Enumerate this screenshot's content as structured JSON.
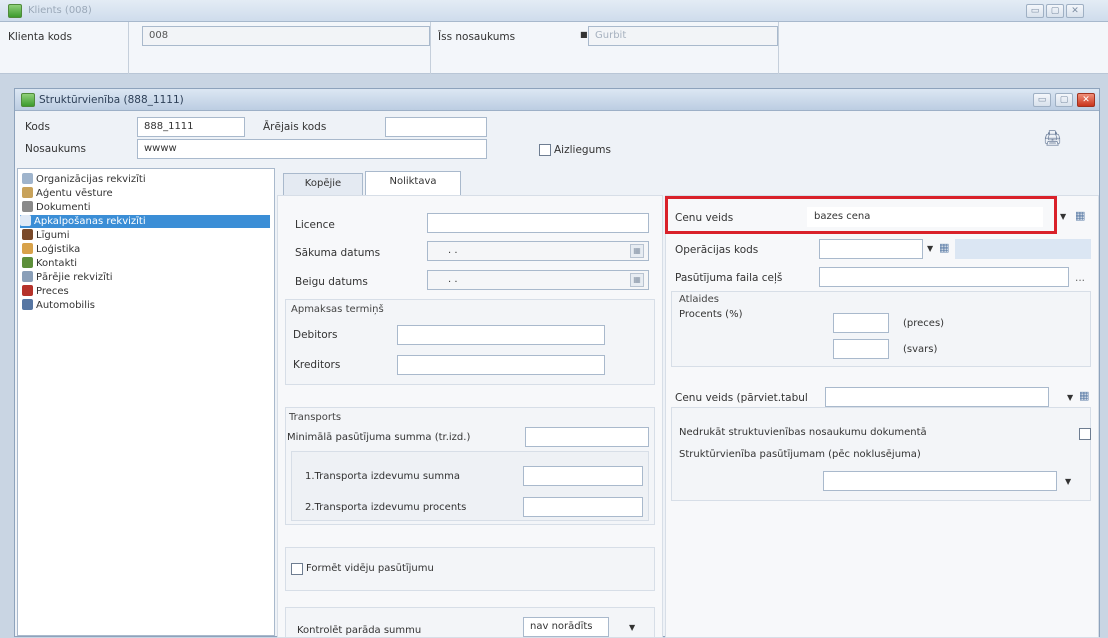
{
  "outer_window": {
    "title": "Klients (008)"
  },
  "client": {
    "code_label": "Klienta kods",
    "code_value": "008",
    "short_name_label": "Īss nosaukums",
    "short_name_value": "Gurbit"
  },
  "inner_window": {
    "title": "Struktūrvienība (888_1111)"
  },
  "form": {
    "code_label": "Kods",
    "code_value": "888_1111",
    "external_code_label": "Ārējais kods",
    "external_code_value": "",
    "name_label": "Nosaukums",
    "name_value": "wwww",
    "blocked_label": "Aizliegums"
  },
  "tree": {
    "items": [
      {
        "label": "Organizācijas rekvizīti",
        "color": "#9fb4cc"
      },
      {
        "label": "Aģentu vēsture",
        "color": "#c8a25a"
      },
      {
        "label": "Dokumenti",
        "color": "#8a8a8a"
      },
      {
        "label": "Apkalpošanas rekvizīti",
        "color": "#3b8ed6",
        "selected": true
      },
      {
        "label": "Līgumi",
        "color": "#7a4a2a"
      },
      {
        "label": "Loģistika",
        "color": "#d8a24a"
      },
      {
        "label": "Kontakti",
        "color": "#5d8f3a"
      },
      {
        "label": "Pārējie rekvizīti",
        "color": "#8a9fb8"
      },
      {
        "label": "Preces",
        "color": "#b5322a"
      },
      {
        "label": "Automobilis",
        "color": "#5676a3"
      }
    ]
  },
  "tabs": [
    {
      "label": "Kopējie",
      "active": false
    },
    {
      "label": "Noliktava",
      "active": true
    }
  ],
  "left": {
    "license_label": "Licence",
    "license_value": "",
    "start_date_label": "Sākuma datums",
    "start_date_value": ". .",
    "end_date_label": "Beigu datums",
    "end_date_value": ". .",
    "payment_term_label": "Apmaksas termiņš",
    "debtors_label": "Debitors",
    "debtors_value": "",
    "creditors_label": "Kreditors",
    "creditors_value": "",
    "transport_label": "Transports",
    "min_order_label": "Minimālā pasūtījuma summa (tr.izd.)",
    "min_order_value": "",
    "transport_cost_sum_label": "1.Transporta izdevumu summa",
    "transport_cost_sum_value": "",
    "transport_cost_pct_label": "2.Transporta izdevumu procents",
    "transport_cost_pct_value": "",
    "form_avg_order_label": "Formēt vidēju pasūtījumu",
    "check_debt_label": "Kontrolēt parāda summu",
    "check_debt_value": "nav norādīts"
  },
  "right": {
    "price_type_label": "Cenu veids",
    "price_type_value": "bazes cena",
    "operation_code_label": "Operācijas kods",
    "operation_code_value": "",
    "order_file_path_label": "Pasūtījuma faila ceļš",
    "order_file_path_value": "",
    "discounts_label": "Atlaides",
    "percent_label": "Procents (%)",
    "goods_label": "(preces)",
    "weight_label": "(svars)",
    "price_type_move_label": "Cenu veids (pārviet.tabul",
    "price_type_move_value": "",
    "no_print_label": "Nedrukāt struktuvienības nosaukumu dokumentā",
    "default_unit_label": "Struktūrvienība pasūtījumam (pēc noklusējuma)",
    "default_unit_value": ""
  },
  "icons": {
    "print": "printer-icon",
    "calendar": "calendar-icon",
    "dropdown": "chevron-down-icon",
    "grid": "grid-icon"
  }
}
